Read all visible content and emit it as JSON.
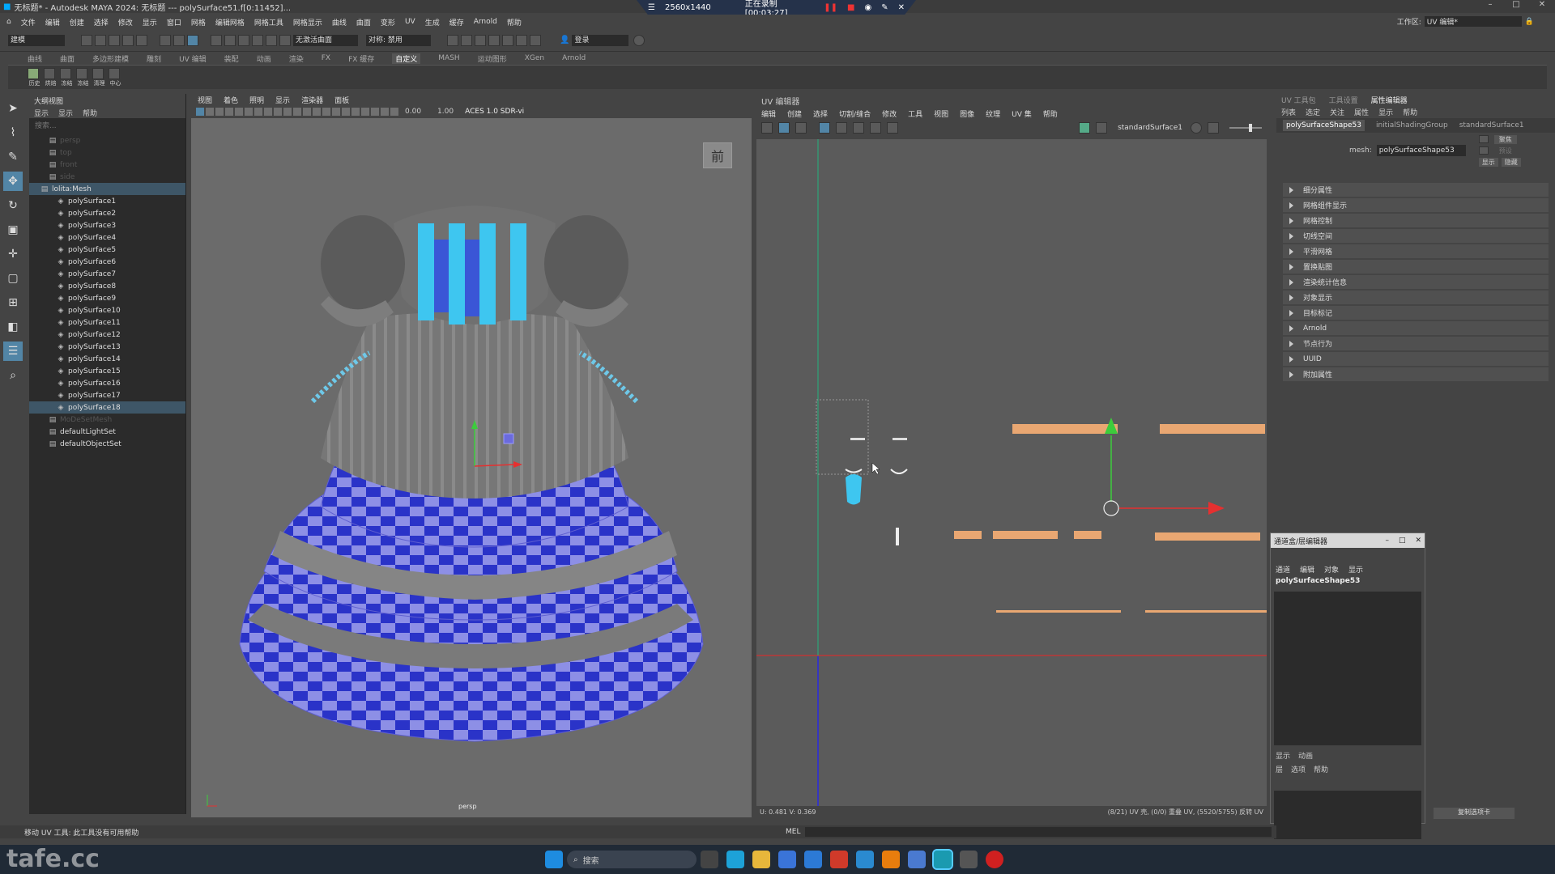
{
  "window": {
    "title": "无标题* - Autodesk MAYA 2024: 无标题   ---   polySurface51.f[0:11452]...",
    "minimize": "–",
    "maximize": "□",
    "close": "✕"
  },
  "recorder": {
    "resolution": "2560x1440",
    "status": "正在录制 [00:03:27]"
  },
  "menubar": {
    "items": [
      "文件",
      "编辑",
      "创建",
      "选择",
      "修改",
      "显示",
      "窗口",
      "网格",
      "编辑网格",
      "网格工具",
      "网格显示",
      "曲线",
      "曲面",
      "变形",
      "UV",
      "生成",
      "缓存",
      "Arnold",
      "帮助"
    ],
    "workspace_label": "工作区:",
    "workspace_value": "UV 编辑*"
  },
  "statusline": {
    "mode": "建模",
    "live_surface": "无激活曲面",
    "symmetry": "对称: 禁用",
    "login": "登录"
  },
  "shelf": {
    "tabs": [
      "曲线",
      "曲面",
      "多边形建模",
      "雕刻",
      "UV 编辑",
      "装配",
      "动画",
      "渲染",
      "FX",
      "FX 缓存",
      "自定义",
      "MASH",
      "运动图形",
      "XGen",
      "Arnold"
    ],
    "active": "自定义",
    "buttons": [
      "历史",
      "烘焙",
      "冻结",
      "冻结",
      "清理",
      "中心"
    ]
  },
  "outliner": {
    "title": "大纲视图",
    "menu": [
      "显示",
      "显示",
      "帮助"
    ],
    "search_placeholder": "搜索...",
    "items": [
      {
        "label": "persp",
        "dim": true,
        "indent": 1
      },
      {
        "label": "top",
        "dim": true,
        "indent": 1
      },
      {
        "label": "front",
        "dim": true,
        "indent": 1
      },
      {
        "label": "side",
        "dim": true,
        "indent": 1
      },
      {
        "label": "lolita:Mesh",
        "dim": false,
        "indent": 0,
        "sel": true
      },
      {
        "label": "polySurface1",
        "indent": 2
      },
      {
        "label": "polySurface2",
        "indent": 2
      },
      {
        "label": "polySurface3",
        "indent": 2
      },
      {
        "label": "polySurface4",
        "indent": 2
      },
      {
        "label": "polySurface5",
        "indent": 2
      },
      {
        "label": "polySurface6",
        "indent": 2
      },
      {
        "label": "polySurface7",
        "indent": 2
      },
      {
        "label": "polySurface8",
        "indent": 2
      },
      {
        "label": "polySurface9",
        "indent": 2
      },
      {
        "label": "polySurface10",
        "indent": 2
      },
      {
        "label": "polySurface11",
        "indent": 2
      },
      {
        "label": "polySurface12",
        "indent": 2
      },
      {
        "label": "polySurface13",
        "indent": 2
      },
      {
        "label": "polySurface14",
        "indent": 2
      },
      {
        "label": "polySurface15",
        "indent": 2
      },
      {
        "label": "polySurface16",
        "indent": 2
      },
      {
        "label": "polySurface17",
        "indent": 2
      },
      {
        "label": "polySurface18",
        "indent": 2,
        "sel": true
      },
      {
        "label": "MoDeSetMesh",
        "dim": true,
        "indent": 1
      },
      {
        "label": "defaultLightSet",
        "indent": 1
      },
      {
        "label": "defaultObjectSet",
        "indent": 1
      }
    ]
  },
  "viewport": {
    "menu": [
      "视图",
      "着色",
      "照明",
      "显示",
      "渲染器",
      "面板"
    ],
    "value_a": "0.00",
    "value_b": "1.00",
    "colorspace": "ACES 1.0 SDR-vi",
    "camera": "persp",
    "view_cube": "前"
  },
  "uv_editor": {
    "title": "UV 编辑器",
    "menu": [
      "编辑",
      "创建",
      "选择",
      "切割/缝合",
      "修改",
      "工具",
      "视图",
      "图像",
      "纹理",
      "UV 集",
      "帮助"
    ],
    "texture": "standardSurface1",
    "status_left": "U: 0.481 V: 0.369",
    "status_right": "(8/21) UV 壳, (0/0) 重叠 UV, (5520/5755) 反转 UV"
  },
  "attribute_editor": {
    "top_tabs": [
      "UV 工具包",
      "工具设置",
      "属性编辑器"
    ],
    "active_tab": "属性编辑器",
    "menu": [
      "列表",
      "选定",
      "关注",
      "属性",
      "显示",
      "帮助"
    ],
    "node_tabs": [
      "polySurfaceShape53",
      "initialShadingGroup",
      "standardSurface1"
    ],
    "mesh_label": "mesh:",
    "mesh_value": "polySurfaceShape53",
    "focus_btn": "聚焦",
    "preset_btn": "预设",
    "show_btn": "显示",
    "hide_btn": "隐藏",
    "sections": [
      "细分属性",
      "网格组件显示",
      "网格控制",
      "切线空间",
      "平滑网格",
      "置换贴图",
      "渲染统计信息",
      "对象显示",
      "目标标记",
      "Arnold",
      "节点行为",
      "UUID",
      "附加属性"
    ]
  },
  "relationship_editor": {
    "title": "通道盒/层编辑器",
    "menu": [
      "通道",
      "编辑",
      "对象",
      "显示"
    ],
    "object": "polySurfaceShape53",
    "lower_tabs": [
      "显示",
      "动画"
    ],
    "lower_menu": [
      "层",
      "选项",
      "帮助"
    ]
  },
  "bottom": {
    "help": "移动 UV 工具: 此工具没有可用帮助",
    "mel_label": "MEL",
    "copy_tab": "复制选项卡"
  },
  "taskbar": {
    "search_placeholder": "搜索"
  },
  "watermark": "tafe.cc",
  "colors": {
    "accent": "#5285a6",
    "uv_shell": "#e9a772",
    "manip_x": "#e53030",
    "manip_y": "#3ccc3c",
    "selection": "#3e5667"
  }
}
